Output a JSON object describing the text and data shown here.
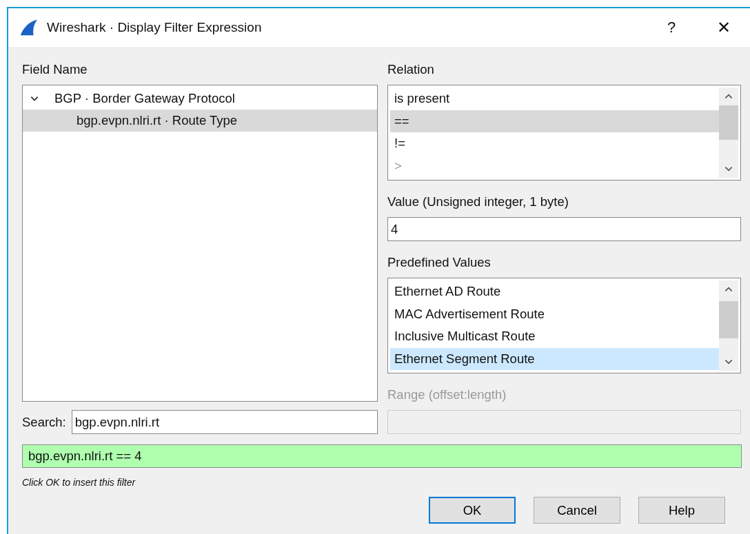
{
  "window": {
    "title": "Wireshark · Display Filter Expression",
    "help": "?",
    "close": "✕"
  },
  "field_name": {
    "label": "Field Name",
    "tree": [
      {
        "label": "BGP · Border Gateway Protocol",
        "expanded": true,
        "selected": false,
        "children": [
          {
            "label": "bgp.evpn.nlri.rt · Route Type",
            "selected": true
          }
        ]
      }
    ]
  },
  "relation": {
    "label": "Relation",
    "items": [
      {
        "label": "is present",
        "selected": false,
        "disabled": false
      },
      {
        "label": "==",
        "selected": true,
        "disabled": false
      },
      {
        "label": "!=",
        "selected": false,
        "disabled": false
      },
      {
        "label": ">",
        "selected": false,
        "disabled": true
      }
    ]
  },
  "value": {
    "label": "Value (Unsigned integer, 1 byte)",
    "value": "4"
  },
  "predefined_values": {
    "label": "Predefined Values",
    "items": [
      {
        "label": "Ethernet AD Route",
        "selected": false
      },
      {
        "label": "MAC Advertisement Route",
        "selected": false
      },
      {
        "label": "Inclusive Multicast Route",
        "selected": false
      },
      {
        "label": "Ethernet Segment Route",
        "selected": true
      }
    ]
  },
  "range": {
    "label": "Range (offset:length)",
    "disabled": true
  },
  "search": {
    "label": "Search:",
    "value": "bgp.evpn.nlri.rt"
  },
  "filter": {
    "value": "bgp.evpn.nlri.rt == 4",
    "valid": true
  },
  "hint": "Click OK to insert this filter",
  "buttons": [
    {
      "label": "OK",
      "default": true
    },
    {
      "label": "Cancel",
      "default": false
    },
    {
      "label": "Help",
      "default": false
    }
  ]
}
